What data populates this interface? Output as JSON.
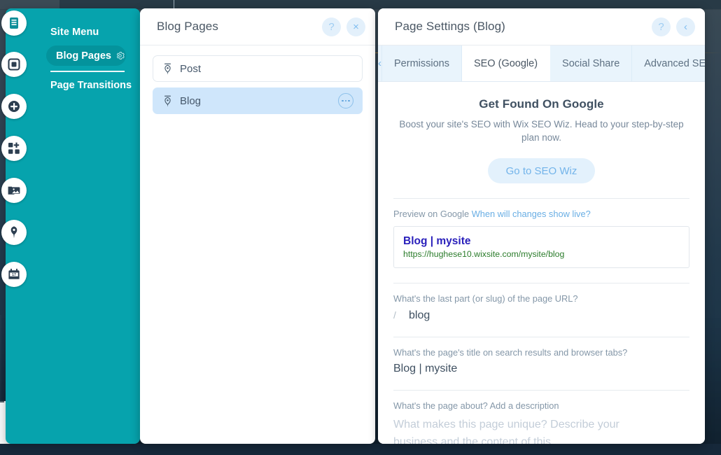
{
  "rail": {
    "icons": [
      {
        "name": "pages-menu-icon",
        "label": "Menu & Pages"
      },
      {
        "name": "background-icon",
        "label": "Background"
      },
      {
        "name": "add-icon",
        "label": "Add"
      },
      {
        "name": "add-apps-icon",
        "label": "Add Apps"
      },
      {
        "name": "my-uploads-icon",
        "label": "My Uploads"
      },
      {
        "name": "blog-pen-icon",
        "label": "Blog"
      },
      {
        "name": "bookings-calendar-icon",
        "label": "Bookings"
      }
    ]
  },
  "site_menu": {
    "title": "Site Menu",
    "active_item": "Blog Pages",
    "gear_icon": "gear-icon",
    "second_item": "Page Transitions"
  },
  "pages_panel": {
    "title": "Blog Pages",
    "help_label": "?",
    "close_label": "×",
    "pages": [
      {
        "name": "Post",
        "selected": false,
        "icon": "pen-nib-icon"
      },
      {
        "name": "Blog",
        "selected": true,
        "icon": "pen-nib-icon"
      }
    ]
  },
  "settings_panel": {
    "title": "Page Settings (Blog)",
    "help_label": "?",
    "collapse_label": "‹",
    "tab_scroll_left": "‹",
    "tabs": [
      {
        "label": "Permissions",
        "active": false
      },
      {
        "label": "SEO (Google)",
        "active": true
      },
      {
        "label": "Social Share",
        "active": false
      },
      {
        "label": "Advanced SEO",
        "active": false
      }
    ],
    "promo": {
      "heading": "Get Found On Google",
      "body": "Boost your site's SEO with Wix SEO Wiz. Head to your step-by-step plan now.",
      "cta": "Go to SEO Wiz"
    },
    "preview": {
      "label": "Preview on Google",
      "link": "When will changes show live?",
      "result_title": "Blog | mysite",
      "result_url": "https://hughese10.wixsite.com/mysite/blog"
    },
    "slug": {
      "label": "What's the last part (or slug) of the page URL?",
      "prefix": "/",
      "value": "blog"
    },
    "page_title": {
      "label": "What's the page's title on search results and browser tabs?",
      "value": "Blog | mysite"
    },
    "description": {
      "label": "What's the page about? Add a description",
      "placeholder_line1": "What makes this page unique? Describe your",
      "placeholder_line2": "business and the content of this"
    }
  },
  "colors": {
    "teal": "#06a3ad",
    "teal_dark": "#04939c",
    "accent_blue": "#73b4ea",
    "tab_strip": "#e9f4fc",
    "selected_row": "#cfe6fb",
    "google_title": "#2a20bb",
    "google_url": "#2b7c2b",
    "canvas_dark": "#1d3040"
  }
}
